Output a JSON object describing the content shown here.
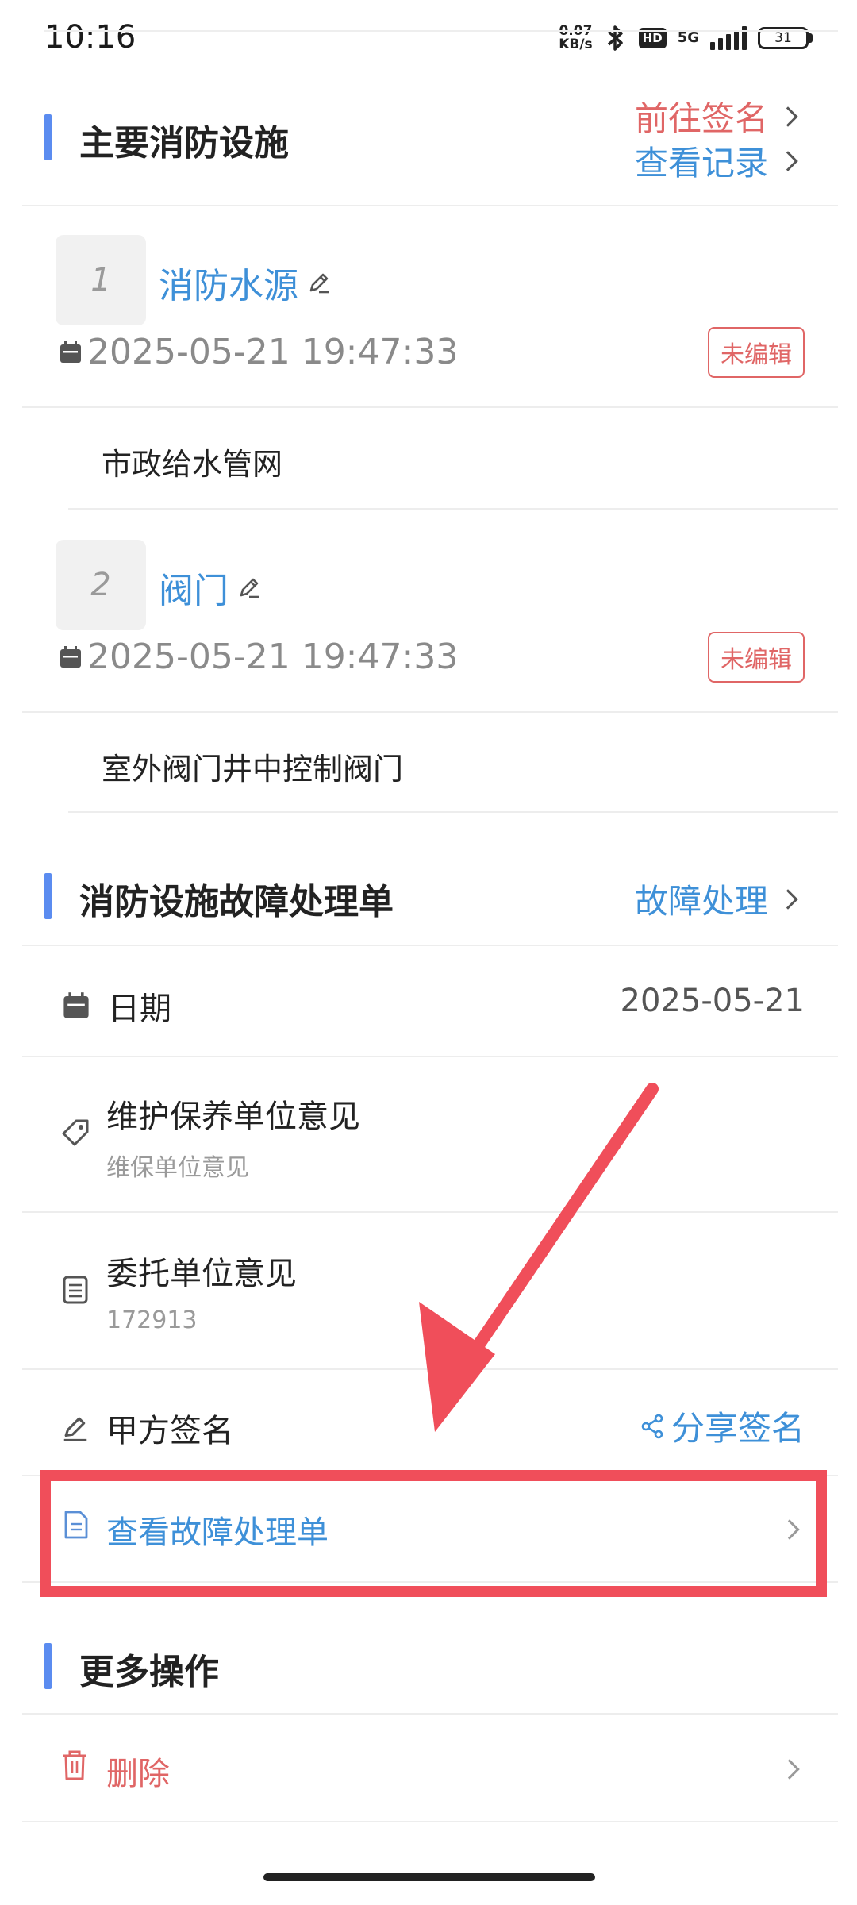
{
  "status_bar": {
    "time": "10:16",
    "net_speed_value": "0.07",
    "net_speed_unit": "KB/s",
    "hd_label": "HD",
    "network": "5G",
    "battery": "31"
  },
  "main_facilities": {
    "title": "主要消防设施",
    "go_sign_label": "前往签名",
    "view_records_label": "查看记录",
    "items": [
      {
        "index": "1",
        "name": "消防水源",
        "datetime": "2025-05-21 19:47:33",
        "status": "未编辑",
        "description": "市政给水管网"
      },
      {
        "index": "2",
        "name": "阀门",
        "datetime": "2025-05-21 19:47:33",
        "status": "未编辑",
        "description": "室外阀门井中控制阀门"
      }
    ]
  },
  "fault_form": {
    "title": "消防设施故障处理单",
    "fault_handle_label": "故障处理",
    "date_label": "日期",
    "date_value": "2025-05-21",
    "maint_opinion_label": "维护保养单位意见",
    "maint_opinion_value": "维保单位意见",
    "client_opinion_label": "委托单位意见",
    "client_opinion_value": "172913",
    "party_a_sign_label": "甲方签名",
    "share_sign_label": "分享签名",
    "view_form_label": "查看故障处理单"
  },
  "more_actions": {
    "title": "更多操作",
    "delete_label": "删除"
  },
  "colors": {
    "accent_blue": "#3e90d8",
    "accent_red": "#e06666",
    "section_bar": "#5b8cf0",
    "highlight_red": "#f04e5a"
  }
}
